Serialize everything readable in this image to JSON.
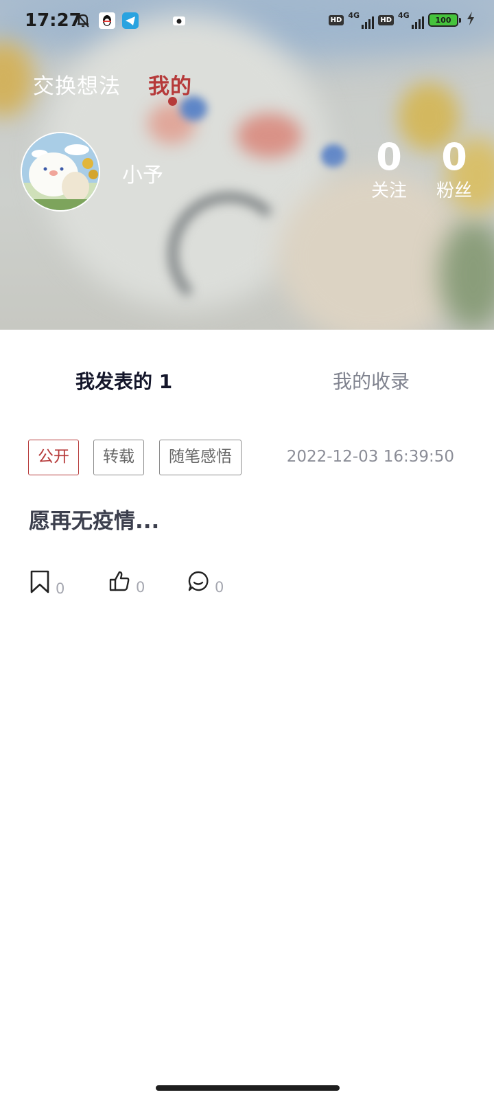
{
  "status_bar": {
    "time": "17:27",
    "network": [
      "4G",
      "4G"
    ],
    "hd": [
      "HD",
      "HD"
    ],
    "battery": "100"
  },
  "top_tabs": [
    {
      "label": "交换想法",
      "active": false
    },
    {
      "label": "我的",
      "active": true
    }
  ],
  "profile": {
    "username": "小予",
    "stats": [
      {
        "value": "0",
        "label": "关注"
      },
      {
        "value": "0",
        "label": "粉丝"
      }
    ]
  },
  "content_tabs": [
    {
      "label": "我发表的 1",
      "active": true
    },
    {
      "label": "我的收录",
      "active": false
    }
  ],
  "post": {
    "tags": [
      "公开",
      "转载",
      "随笔感悟"
    ],
    "time": "2022-12-03 16:39:50",
    "content": "愿再无疫情...",
    "actions": [
      {
        "icon": "bookmark-icon",
        "count": "0"
      },
      {
        "icon": "thumbs-up-icon",
        "count": "0"
      },
      {
        "icon": "comment-icon",
        "count": "0"
      }
    ]
  },
  "colors": {
    "accent": "#b63a3a",
    "title_dark": "#14162a",
    "muted": "#80838f"
  }
}
